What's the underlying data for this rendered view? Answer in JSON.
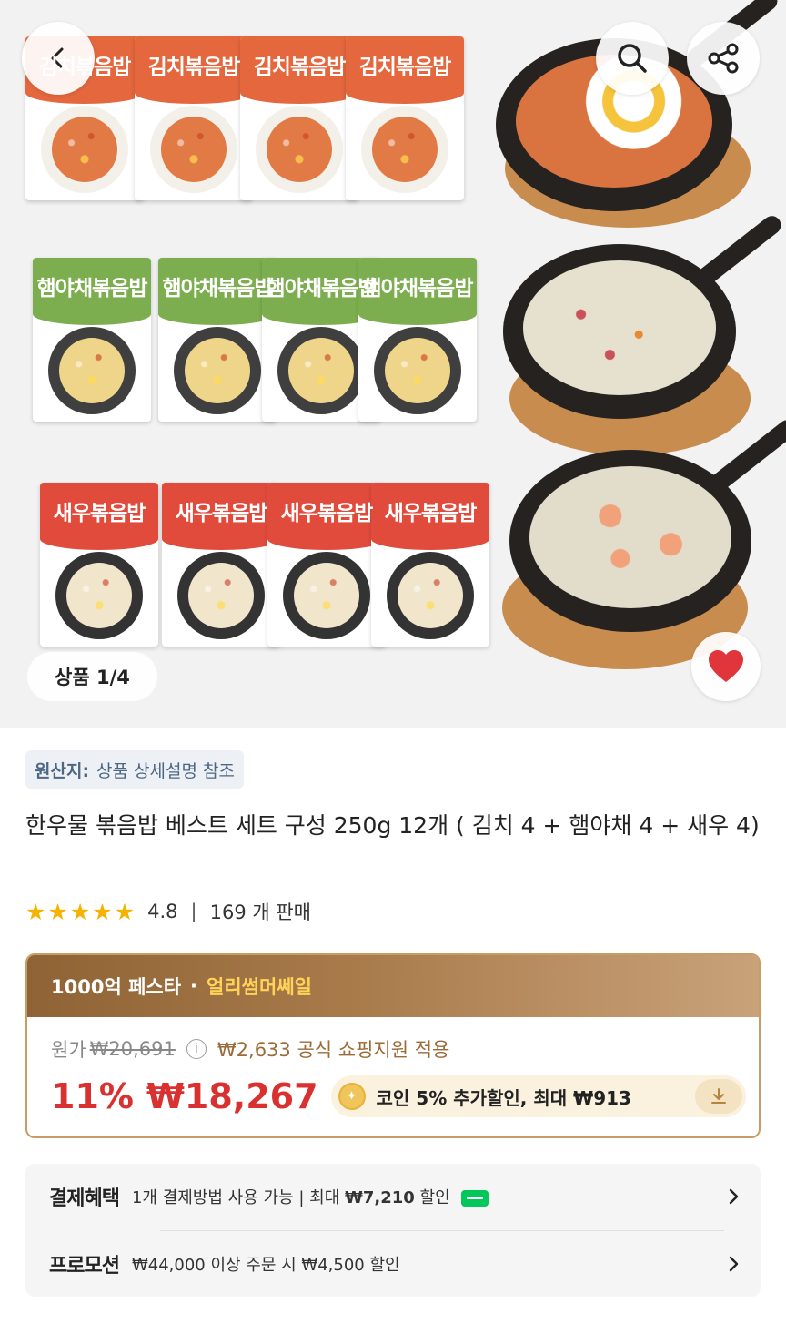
{
  "gallery": {
    "counter": "상품 1/4",
    "packs": {
      "kimchi": "김치볶음밥",
      "ham": "햄야채볶음밥",
      "shrimp": "새우볶음밥"
    }
  },
  "origin": {
    "label": "원산지:",
    "value": "상품 상세설명 참조"
  },
  "product": {
    "title": "한우물  볶음밥 베스트 세트 구성 250g 12개  ( 김치 4 + 햄야채 4 + 새우 4)",
    "rating": "4.8",
    "rating_stars": 5,
    "sales": "169 개 판매"
  },
  "price": {
    "banner_main": "1000억 페스타",
    "banner_dot": "·",
    "banner_highlight": "얼리썸머쎄일",
    "original_label": "원가",
    "original_price": "₩20,691",
    "support_text": "₩2,633 공식 쇼핑지원 적용",
    "discount_rate": "11%",
    "sale_price": "₩18,267",
    "coin_text": "코인 5% 추가할인, 최대 ₩913"
  },
  "benefits": [
    {
      "title": "결제혜택",
      "text_pre": "1개 결제방법 사용 가능 | 최대 ",
      "text_bold": "₩7,210",
      "text_post": " 할인"
    },
    {
      "title": "프로모션",
      "text_pre": "₩44,000 이상 주문 시 ₩4,500 할인",
      "text_bold": "",
      "text_post": ""
    }
  ],
  "colors": {
    "accent": "#d8312f",
    "gold": "#c79d64",
    "kimchi": "#e4673e",
    "ham": "#7cae4f",
    "shrimp": "#e04b3c"
  }
}
